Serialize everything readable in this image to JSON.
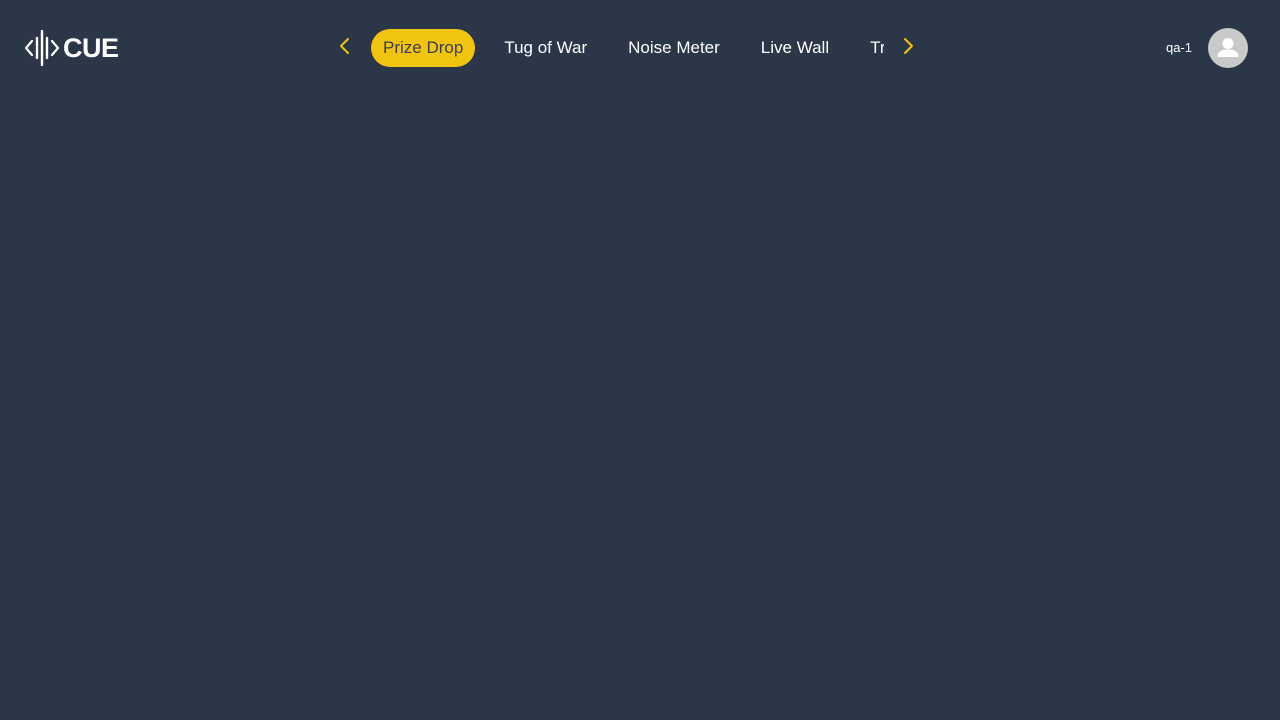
{
  "brand": {
    "name": "CUE",
    "logo_icon": "cue-waveform-icon"
  },
  "nav": {
    "prev_icon": "chevron-left-icon",
    "next_icon": "chevron-right-icon",
    "arrow_color": "#f1c40f",
    "tabs": [
      {
        "label": "Prize Drop",
        "active": true
      },
      {
        "label": "Tug of War",
        "active": false
      },
      {
        "label": "Noise Meter",
        "active": false
      },
      {
        "label": "Live Wall",
        "active": false
      },
      {
        "label": "Tri",
        "active": false
      }
    ]
  },
  "user": {
    "name": "qa-1",
    "avatar_icon": "user-avatar-icon"
  },
  "colors": {
    "background": "#2c3649",
    "accent": "#f1c40f",
    "avatar_bg": "#c9c9c9"
  }
}
